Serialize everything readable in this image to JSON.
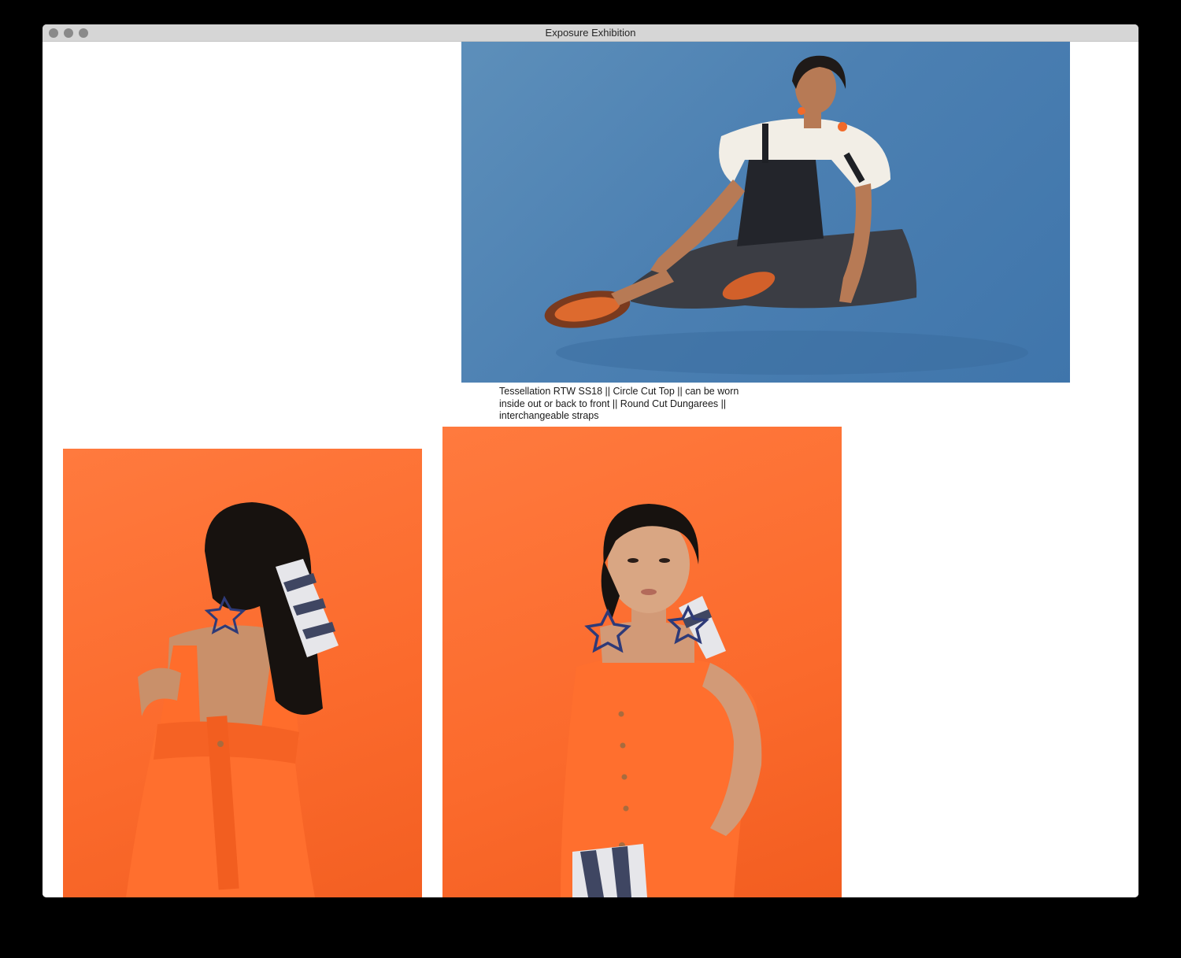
{
  "window": {
    "title": "Exposure Exhibition"
  },
  "gallery": {
    "caption": "Tessellation RTW SS18 || Circle Cut Top || can be worn inside out or back to front || Round Cut Dungarees || interchangeable straps",
    "photos": [
      {
        "name": "seated-model-photo",
        "background_color": "#4c80b2"
      },
      {
        "name": "back-view-model-photo",
        "background_color": "#fb6a2c"
      },
      {
        "name": "front-view-model-photo",
        "background_color": "#fb6a2c"
      }
    ]
  },
  "colors": {
    "page_background": "#ffffff",
    "titlebar": "#d6d6d6",
    "screen_background": "#000000"
  }
}
